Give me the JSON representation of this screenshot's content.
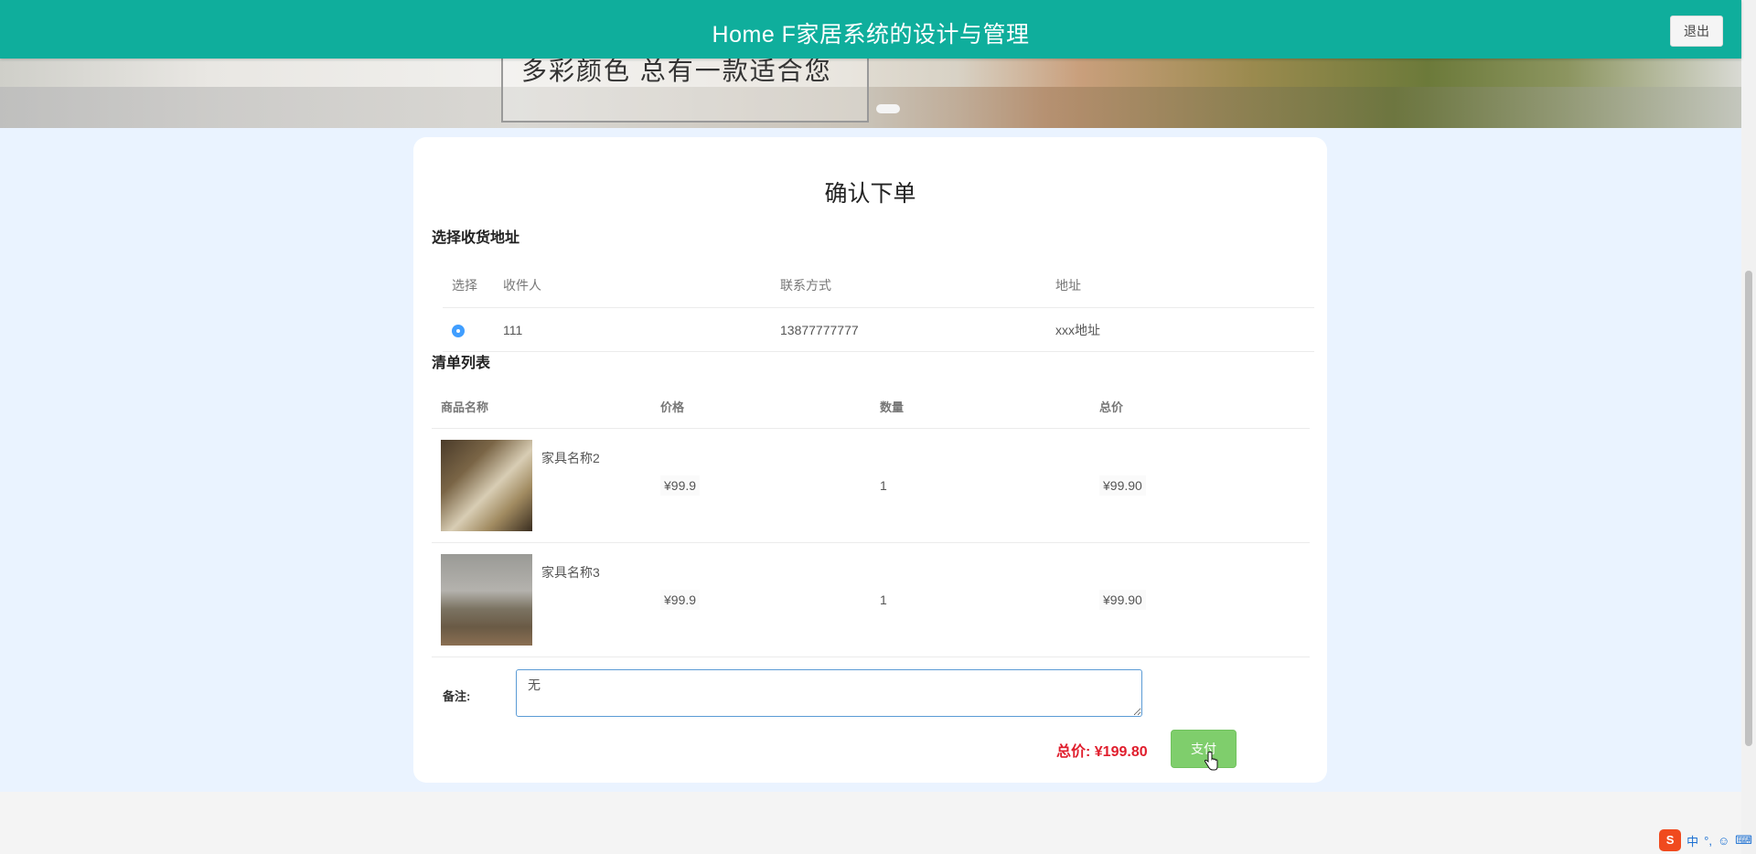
{
  "header": {
    "title": "Home F家居系统的设计与管理",
    "logout_label": "退出"
  },
  "banner": {
    "slogan": "多彩颜色  总有一款适合您"
  },
  "page": {
    "title": "确认下单"
  },
  "address_section": {
    "title": "选择收货地址",
    "columns": [
      "选择",
      "收件人",
      "联系方式",
      "地址"
    ],
    "rows": [
      {
        "selected": true,
        "recipient": "111",
        "phone": "13877777777",
        "address": "xxx地址"
      }
    ]
  },
  "list_section": {
    "title": "清单列表",
    "columns": [
      "商品名称",
      "价格",
      "数量",
      "总价"
    ],
    "rows": [
      {
        "name": "家具名称2",
        "price": "¥99.9",
        "quantity": "1",
        "subtotal": "¥99.90"
      },
      {
        "name": "家具名称3",
        "price": "¥99.9",
        "quantity": "1",
        "subtotal": "¥99.90"
      }
    ]
  },
  "remark": {
    "label": "备注:",
    "value": "无"
  },
  "summary": {
    "total_text": "总价: ¥199.80",
    "pay_label": "支付"
  },
  "tray": {
    "ime_logo": "S",
    "ime_mode": "中",
    "punct": "°,",
    "emoji_icon": "emoji-icon",
    "keyboard_icon": "keyboard-icon"
  },
  "colors": {
    "header_bg": "#0fae9c",
    "accent_blue": "#409eff",
    "price_red": "#e01e2d",
    "pay_green": "#7fce6c"
  }
}
